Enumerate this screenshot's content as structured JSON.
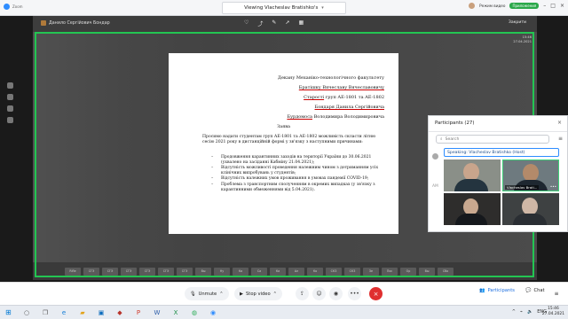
{
  "titlebar": {
    "app_label": "Zoom",
    "share_title": "Viewing Vlacheslav Bratishko's",
    "right_label": "Режим видео",
    "green_label": "Приложения"
  },
  "annotation": {
    "presenter_name": "Данило Сергійович Бондар",
    "close_label": "Закрити"
  },
  "document": {
    "line1": "Декану Механіко-технологічного факультету",
    "line2": "Братішку Вячеславу Вячеславовичу",
    "line3_part1": "Старості",
    "line3_part2": " груп АЕ-1801 та АЕ-1802",
    "line4": "Бондаря Данила Сергійовича",
    "line5_part1": "Бурдомоса",
    "line5_part2": " Володимира Володимировича",
    "heading": "Заява",
    "paragraph": "Просимо надати студентам груп АЕ-1801 та АЕ-1802 можливість скласти літню сесію 2021 року в дистанційній формі у зв'язку з наступними причинами:",
    "bullets": [
      "Продовження карантинних заходів на території України до 30.06.2021 (ухвалено на засіданні Кабміну 21.04.2021);",
      "Відсутність можливості проведення належним чином з дотриманням усіх клінічних випробувань у студентів;",
      "Відсутність належних умов проживання в умовах пандемії COVID-19;",
      "Проблема з транспортним сполученням в окремих випадках (у зв'язку з карантинними обмеженнями від 5.04.2021)."
    ]
  },
  "participants": {
    "title": "Participants (27)",
    "search_placeholder": "Search",
    "speaking": "Speaking: Vlacheslav Bratishko (Host)",
    "rows": [
      "AM"
    ]
  },
  "videos": [
    {
      "name": ""
    },
    {
      "name": "Vlacheslav Brati..."
    },
    {
      "name": ""
    },
    {
      "name": ""
    }
  ],
  "shared_taskbar": {
    "clock_time": "15:46",
    "clock_date": "27.04.2021",
    "items": [
      "Rifle",
      "СГЭ",
      "СГЭ",
      "СГЭ",
      "СГЭ",
      "СГЭ",
      "СГЭ",
      "Вы",
      "Ну",
      "Ка",
      "Са",
      "Ка",
      "Ал",
      "Ко",
      "СКЗ",
      "СКЗ",
      "Зе",
      "Пос",
      "Ор",
      "Вы",
      "Сбо"
    ]
  },
  "controls": {
    "unmute": "Unmute",
    "stop_video": "Stop video",
    "participants": "Participants",
    "chat": "Chat"
  },
  "windows_taskbar": {
    "lang": "ENG",
    "time": "15:46",
    "date": "27.04.2021"
  }
}
